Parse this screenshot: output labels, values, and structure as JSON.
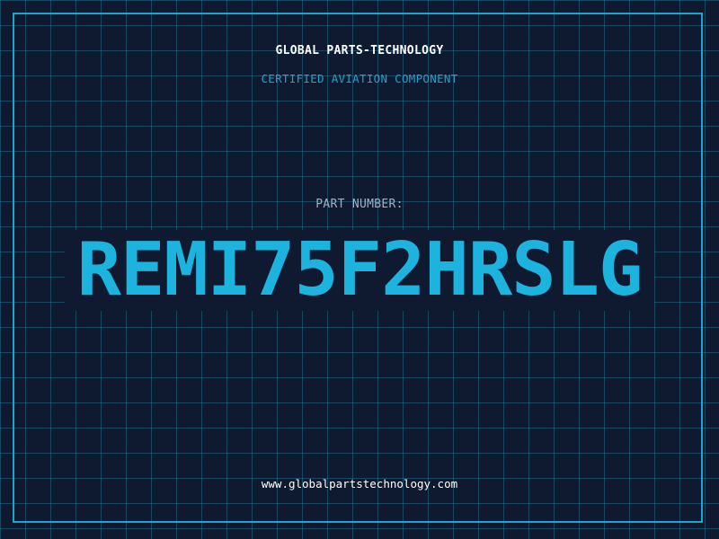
{
  "header": {
    "company": "GLOBAL PARTS-TECHNOLOGY",
    "tagline": "CERTIFIED AVIATION COMPONENT"
  },
  "part": {
    "label": "PART NUMBER:",
    "number": "REMI75F2HRSLG"
  },
  "footer": {
    "website": "www.globalpartstechnology.com"
  },
  "colors": {
    "background": "#0f1a30",
    "grid": "#1e82a0",
    "accent": "#1cb3de",
    "label": "#a3b0c2",
    "text": "#ffffff"
  }
}
